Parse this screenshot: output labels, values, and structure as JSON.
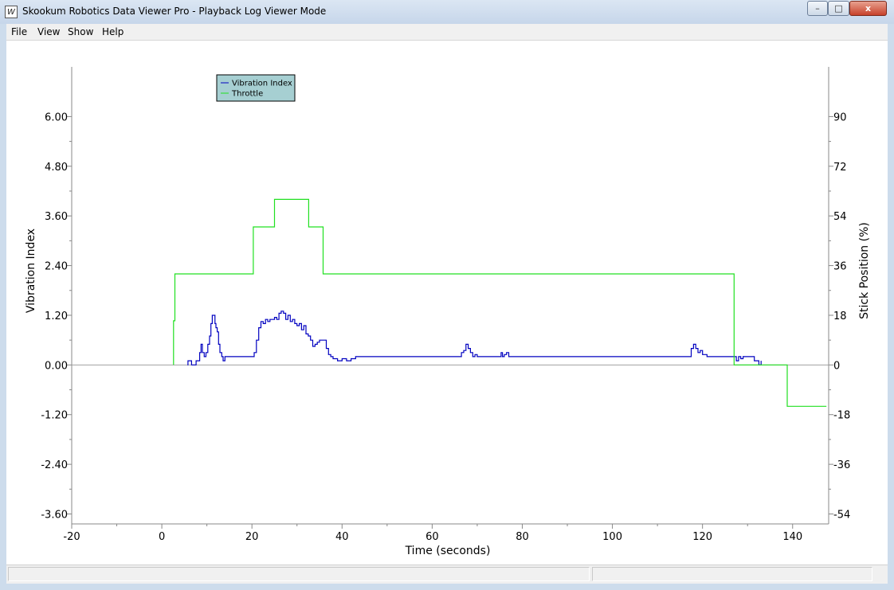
{
  "window": {
    "title": "Skookum Robotics Data Viewer Pro - Playback Log Viewer Mode",
    "minimize_label": "–",
    "maximize_label": "□",
    "close_label": "x",
    "app_icon_glyph": "W"
  },
  "menu": [
    "File",
    "View",
    "Show",
    "Help"
  ],
  "chart_data": {
    "type": "line",
    "xlabel": "Time (seconds)",
    "ylabel": "Vibration Index",
    "y2label": "Stick Position (%)",
    "xlim": [
      -20,
      148
    ],
    "ylim": [
      -3.6,
      6.0
    ],
    "y2lim": [
      -54,
      90
    ],
    "xticks": [
      -20,
      0,
      20,
      40,
      60,
      80,
      100,
      120,
      140
    ],
    "yticks": [
      "6.00",
      "4.80",
      "3.60",
      "2.40",
      "1.20",
      "0.00",
      "-1.20",
      "-2.40",
      "-3.60"
    ],
    "y2ticks": [
      "90",
      "72",
      "54",
      "36",
      "18",
      "0",
      "-18",
      "-36",
      "-54"
    ],
    "legend_placement": "top-left",
    "series": [
      {
        "name": "Vibration Index",
        "axis": "left",
        "color": "#0000c0",
        "points": [
          [
            5.7,
            0
          ],
          [
            5.8,
            0.1
          ],
          [
            6.5,
            0.1
          ],
          [
            6.6,
            0
          ],
          [
            7.5,
            0
          ],
          [
            7.6,
            0.1
          ],
          [
            8,
            0.1
          ],
          [
            8.4,
            0.3
          ],
          [
            8.7,
            0.5
          ],
          [
            9,
            0.3
          ],
          [
            9.4,
            0.2
          ],
          [
            9.8,
            0.3
          ],
          [
            10.2,
            0.5
          ],
          [
            10.6,
            0.7
          ],
          [
            10.9,
            1.0
          ],
          [
            11.2,
            1.2
          ],
          [
            11.5,
            1.2
          ],
          [
            11.8,
            1.0
          ],
          [
            12,
            0.9
          ],
          [
            12.3,
            0.8
          ],
          [
            12.6,
            0.5
          ],
          [
            12.9,
            0.3
          ],
          [
            13.3,
            0.2
          ],
          [
            13.6,
            0.1
          ],
          [
            14,
            0.2
          ],
          [
            20,
            0.2
          ],
          [
            20.5,
            0.3
          ],
          [
            21,
            0.6
          ],
          [
            21.5,
            0.9
          ],
          [
            22,
            1.05
          ],
          [
            22.5,
            1.0
          ],
          [
            23,
            1.1
          ],
          [
            23.5,
            1.05
          ],
          [
            24,
            1.1
          ],
          [
            25,
            1.15
          ],
          [
            25.5,
            1.1
          ],
          [
            26,
            1.25
          ],
          [
            26.5,
            1.3
          ],
          [
            27,
            1.25
          ],
          [
            27.5,
            1.1
          ],
          [
            28,
            1.2
          ],
          [
            28.5,
            1.05
          ],
          [
            29,
            1.1
          ],
          [
            29.5,
            1.0
          ],
          [
            30,
            0.95
          ],
          [
            30.5,
            1.0
          ],
          [
            31,
            0.85
          ],
          [
            31.5,
            0.95
          ],
          [
            32,
            0.75
          ],
          [
            32.5,
            0.7
          ],
          [
            33,
            0.6
          ],
          [
            33.5,
            0.45
          ],
          [
            34,
            0.5
          ],
          [
            34.5,
            0.55
          ],
          [
            35,
            0.6
          ],
          [
            36,
            0.6
          ],
          [
            36.5,
            0.4
          ],
          [
            37,
            0.25
          ],
          [
            37.5,
            0.2
          ],
          [
            38,
            0.15
          ],
          [
            39,
            0.1
          ],
          [
            40,
            0.15
          ],
          [
            41,
            0.1
          ],
          [
            42,
            0.15
          ],
          [
            43,
            0.2
          ],
          [
            66,
            0.2
          ],
          [
            66.5,
            0.3
          ],
          [
            67,
            0.35
          ],
          [
            67.5,
            0.5
          ],
          [
            68,
            0.4
          ],
          [
            68.5,
            0.3
          ],
          [
            69,
            0.2
          ],
          [
            69.5,
            0.25
          ],
          [
            70,
            0.2
          ],
          [
            75,
            0.2
          ],
          [
            75.3,
            0.3
          ],
          [
            75.6,
            0.2
          ],
          [
            76,
            0.25
          ],
          [
            76.5,
            0.3
          ],
          [
            77,
            0.2
          ],
          [
            117,
            0.2
          ],
          [
            117.5,
            0.4
          ],
          [
            118,
            0.5
          ],
          [
            118.5,
            0.4
          ],
          [
            119,
            0.3
          ],
          [
            119.5,
            0.35
          ],
          [
            120,
            0.25
          ],
          [
            121,
            0.2
          ],
          [
            127,
            0.2
          ],
          [
            127.5,
            0.1
          ],
          [
            128,
            0.2
          ],
          [
            128.5,
            0.15
          ],
          [
            129,
            0.2
          ],
          [
            131,
            0.2
          ],
          [
            131.5,
            0.1
          ],
          [
            132,
            0.1
          ],
          [
            132.5,
            0
          ],
          [
            133,
            0.1
          ]
        ]
      },
      {
        "name": "Throttle",
        "axis": "right",
        "color": "#20e020",
        "points": [
          [
            2.6,
            0
          ],
          [
            2.6,
            16
          ],
          [
            2.9,
            16
          ],
          [
            2.9,
            33
          ],
          [
            20.3,
            33
          ],
          [
            20.3,
            50
          ],
          [
            25,
            50
          ],
          [
            25,
            60
          ],
          [
            32.6,
            60
          ],
          [
            32.6,
            50
          ],
          [
            35.8,
            50
          ],
          [
            35.8,
            33
          ],
          [
            127,
            33
          ],
          [
            127,
            0
          ],
          [
            138.8,
            0
          ],
          [
            138.8,
            -15
          ],
          [
            147.5,
            -15
          ]
        ]
      }
    ]
  }
}
